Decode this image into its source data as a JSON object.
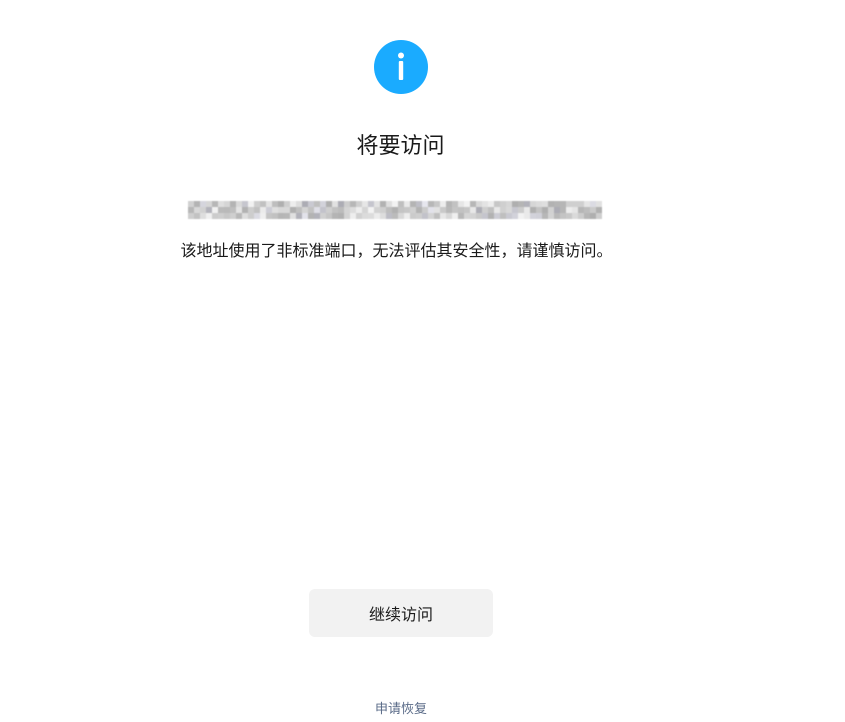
{
  "page": {
    "title": "将要访问",
    "warning": "该地址使用了非标准端口，无法评估其安全性，请谨慎访问。"
  },
  "icon": {
    "name": "info-icon",
    "color": "#1aabff",
    "glyph": "i"
  },
  "actions": {
    "continue_label": "继续访问",
    "restore_label": "申请恢复"
  },
  "colors": {
    "accent": "#1aabff",
    "button_bg": "#f2f2f2",
    "link": "#5a6b88"
  }
}
